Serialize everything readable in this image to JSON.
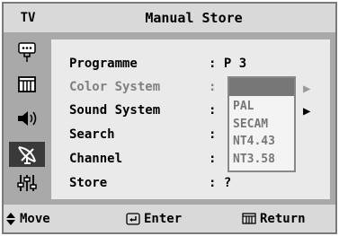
{
  "header": {
    "tv_label": "TV",
    "title": "Manual Store"
  },
  "sidebar": {
    "icons": [
      {
        "name": "input-plug-icon",
        "active": false
      },
      {
        "name": "picture-icon",
        "active": false
      },
      {
        "name": "sound-speaker-icon",
        "active": false
      },
      {
        "name": "channel-antenna-icon",
        "active": true
      },
      {
        "name": "setup-sliders-icon",
        "active": false
      }
    ]
  },
  "menu": {
    "rows": [
      {
        "label": "Programme",
        "value": ": P 3",
        "disabled": false
      },
      {
        "label": "Color System",
        "value": ":",
        "disabled": true
      },
      {
        "label": "Sound System",
        "value": ":",
        "disabled": false
      },
      {
        "label": "Search",
        "value": ":",
        "disabled": false
      },
      {
        "label": "Channel",
        "value": ":",
        "disabled": false
      },
      {
        "label": "Store",
        "value": ": ?",
        "disabled": false
      }
    ]
  },
  "color_system_dropdown": {
    "options": [
      "PAL",
      "SECAM",
      "NT4.43",
      "NT3.58"
    ]
  },
  "footer": {
    "move_label": "Move",
    "enter_label": "Enter",
    "return_label": "Return"
  },
  "colors": {
    "frame": "#a9a9a9",
    "panel": "#eaeaea",
    "header": "#d9d9d9",
    "highlight": "#3a3a3a"
  }
}
